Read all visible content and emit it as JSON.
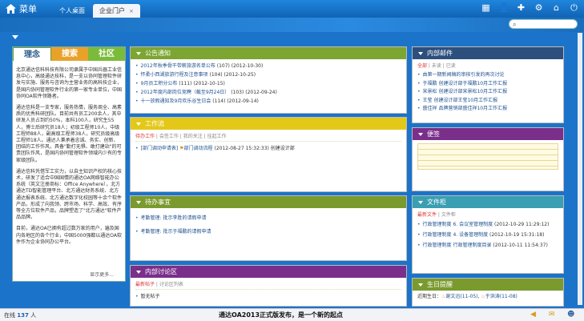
{
  "header": {
    "menu_label": "菜单",
    "tabs": [
      {
        "label": "个人桌面"
      },
      {
        "label": "企业门户",
        "close": "×"
      }
    ],
    "toolbar_icons": [
      "grid-icon",
      "user-icon",
      "puzzle-icon",
      "gear-icon",
      "home-icon",
      "power-icon"
    ],
    "search_placeholder": ""
  },
  "left_panel": {
    "tabs": [
      "理念",
      "搜索",
      "社区"
    ],
    "paragraphs": [
      "北京通达信科科技有限公司隶属于中国兵器工业信息中心，高级通达技科，是一支以协同管理软件研发与实施、服务与咨询为主营业务的高科技企业，是国内协同管理软件行业的第一家专业单位，中国协同OA软件领路者。",
      "通达信科是一支专家，服务热情，服务周全、高素质的优秀科研团队。目前共有员工200余人，其中研发人员占到约50%，本科100人，研究生55人，博士后研究员18人；初级工程师10人，中级工程师88人，副高级工程师38人，研究员级高级工程师18人。通达人秉承着忠诚、务实、创新、团结的工作作风，具备\"勤打无惧、敢打建站\"的可贵团队作风，是国内协同管理软件领域内少有的专家级团队。",
      "通达信科凭借军工实力，以自主知识产权的核心技术，研发了适合中国国情的通达OA网络智能办公系统（英文注册商标：Office Anywhere），北方通达TD智能管理平台、北方通达财务系统、北方通达报表系统、北方通达数字化校园等十余个软件产品，形成了向我领、跨市场、科学、高效、有序等全方位软件产品，品牌塑造了\"北方通达\"软件产品品牌。",
      "目前，通达OA已拥有超过数万家的用户，遍及国内各地区的各个行业，中国5000强都以通达OA软件作为企业协同办公平台。"
    ],
    "more": "显示更多..."
  },
  "notice": {
    "title": "公告通知",
    "items": [
      {
        "text": "2012年秋季骨干带薪旅游名单公布",
        "meta": "(107)  (2012-10-30)"
      },
      {
        "text": "怀柔小西湖旅游行程及注意事项",
        "meta": "(104)  (2012-10-25)"
      },
      {
        "text": "9月员工积分公布",
        "meta": "(111)  (2012-10-15)"
      },
      {
        "text": "2012年度内部岗位竞聘（截至9月24日）",
        "meta": "(103)  (2012-09-24)"
      },
      {
        "text": "十一放假通知及9月欢乐谷生日会",
        "meta": "(114)  (2012-09-14)"
      }
    ]
  },
  "workflow": {
    "title": "工作流",
    "tabs": [
      "待办工作",
      "会签工作",
      "我的关注",
      "挂起工作"
    ],
    "items": [
      {
        "text": "[部门调动申请表]",
        "sub": "部门调动流程",
        "meta": "(2012-08-27  15:32:33)  创建设计部"
      }
    ]
  },
  "todo": {
    "title": "待办事宜",
    "items": [
      {
        "text": "考勤管理: 批示李胜的请假申请"
      },
      {
        "text": "考勤管理: 批示于福鹏的请假申请"
      }
    ]
  },
  "forum": {
    "title": "内部讨论区",
    "tabs": [
      "最新帖子",
      "讨论区列表"
    ],
    "items": [
      {
        "text": "暂无帖子"
      }
    ]
  },
  "mail": {
    "title": "内部邮件",
    "tabs": [
      "全部",
      "未读",
      "已读"
    ],
    "items": [
      {
        "text": "由第一期新闻稿的审核引发的再次讨论"
      },
      {
        "text": "于福鹏  创建设计部于福鹏10月工作汇报"
      },
      {
        "text": "宋景松  创建设计部宋景松10月工作汇报"
      },
      {
        "text": "王莹  创建设计部王莹10月工作汇报"
      },
      {
        "text": "盛佳祥  品牌营销部盛佳祥10月工作汇报"
      }
    ]
  },
  "notes": {
    "title": "便签"
  },
  "files": {
    "title": "文件柜",
    "tabs": [
      "最新文件",
      "文件柜"
    ],
    "items": [
      {
        "text": "行政管理制度 6. 会议室管理制度",
        "meta": "(2012-10-29 11:29:12)"
      },
      {
        "text": "行政管理制度 4. 设备管理制度",
        "meta": "(2012-10-19 15:31:18)"
      },
      {
        "text": "行政管理制度  行政管理制度目录",
        "meta": "(2012-10-11 11:54:37)"
      }
    ]
  },
  "birthday": {
    "title": "生日提醒",
    "label": "近期生日：",
    "people": [
      "谢文迅(11-05)",
      "于洪涛(11-08)"
    ]
  },
  "footer": {
    "online_label": "在线",
    "online_count": "137",
    "online_unit": "人",
    "announcement": "通达OA2013正式版发布，是一个新的起点",
    "icons": [
      "speaker-icon",
      "mail-icon",
      "users-icon"
    ]
  }
}
